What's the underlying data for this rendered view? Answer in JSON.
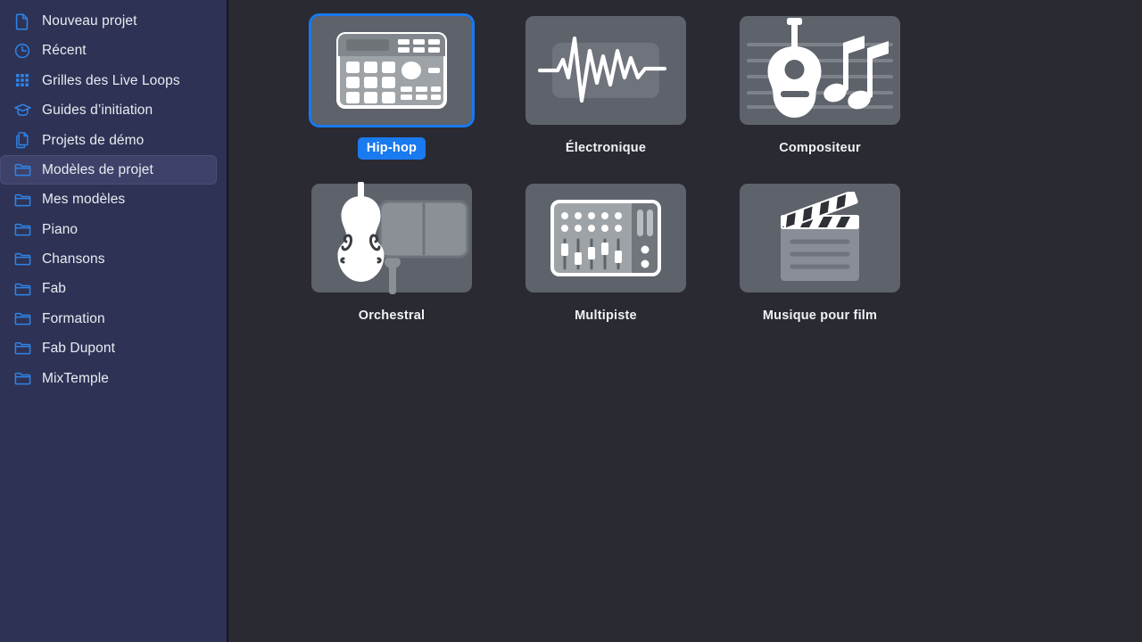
{
  "sidebar": {
    "items": [
      {
        "label": "Nouveau projet",
        "icon": "document-icon",
        "selected": false
      },
      {
        "label": "Récent",
        "icon": "clock-icon",
        "selected": false
      },
      {
        "label": "Grilles des Live Loops",
        "icon": "grid-icon",
        "selected": false
      },
      {
        "label": "Guides d’initiation",
        "icon": "graduation-cap-icon",
        "selected": false
      },
      {
        "label": "Projets de démo",
        "icon": "documents-icon",
        "selected": false
      },
      {
        "label": "Modèles de projet",
        "icon": "folder-icon",
        "selected": true
      },
      {
        "label": "Mes modèles",
        "icon": "folder-icon",
        "selected": false
      },
      {
        "label": "Piano",
        "icon": "folder-icon",
        "selected": false
      },
      {
        "label": "Chansons",
        "icon": "folder-icon",
        "selected": false
      },
      {
        "label": "Fab",
        "icon": "folder-icon",
        "selected": false
      },
      {
        "label": "Formation",
        "icon": "folder-icon",
        "selected": false
      },
      {
        "label": "Fab Dupont",
        "icon": "folder-icon",
        "selected": false
      },
      {
        "label": "MixTemple",
        "icon": "folder-icon",
        "selected": false
      }
    ]
  },
  "main": {
    "templates": [
      {
        "label": "Hip-hop",
        "icon": "drum-machine-icon",
        "selected": true
      },
      {
        "label": "Électronique",
        "icon": "waveform-icon",
        "selected": false
      },
      {
        "label": "Compositeur",
        "icon": "guitar-notes-icon",
        "selected": false
      },
      {
        "label": "Orchestral",
        "icon": "double-bass-icon",
        "selected": false
      },
      {
        "label": "Multipiste",
        "icon": "mixer-icon",
        "selected": false
      },
      {
        "label": "Musique pour film",
        "icon": "clapperboard-icon",
        "selected": false
      }
    ]
  },
  "colors": {
    "sidebar_bg": "#2e3355",
    "sidebar_selected_bg": "#3e4269",
    "main_bg": "#2a2a33",
    "tile_bg": "#5d626b",
    "accent_blue": "#1a7af0",
    "icon_blue": "#2f84e8",
    "text_primary": "#e9ebf2"
  }
}
